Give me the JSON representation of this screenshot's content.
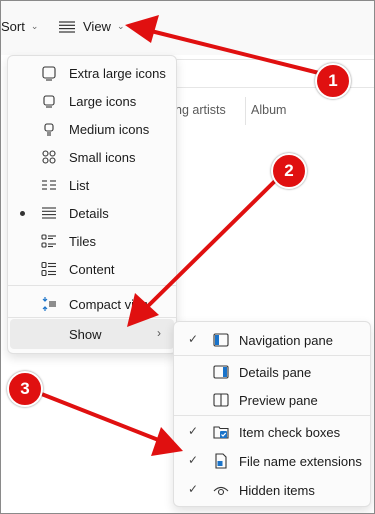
{
  "toolbar": {
    "sort_label": "Sort",
    "view_label": "View"
  },
  "columns": {
    "contributing_artists": "ng artists",
    "album": "Album"
  },
  "view_menu": {
    "items": [
      {
        "label": "Extra large icons",
        "icon": "extra-large-icons-icon"
      },
      {
        "label": "Large icons",
        "icon": "large-icons-icon"
      },
      {
        "label": "Medium icons",
        "icon": "medium-icons-icon"
      },
      {
        "label": "Small icons",
        "icon": "small-icons-icon"
      },
      {
        "label": "List",
        "icon": "list-icon"
      },
      {
        "label": "Details",
        "icon": "details-icon",
        "selected": true
      },
      {
        "label": "Tiles",
        "icon": "tiles-icon"
      },
      {
        "label": "Content",
        "icon": "content-icon"
      },
      {
        "label": "Compact view",
        "icon": "compact-view-icon"
      }
    ],
    "show_label": "Show"
  },
  "show_submenu": {
    "items": [
      {
        "label": "Navigation pane",
        "checked": true,
        "icon": "navigation-pane-icon"
      },
      {
        "label": "Details pane",
        "checked": false,
        "icon": "details-pane-icon"
      },
      {
        "label": "Preview pane",
        "checked": false,
        "icon": "preview-pane-icon"
      },
      {
        "label": "Item check boxes",
        "checked": true,
        "icon": "item-check-boxes-icon"
      },
      {
        "label": "File name extensions",
        "checked": true,
        "icon": "file-name-extensions-icon"
      },
      {
        "label": "Hidden items",
        "checked": true,
        "icon": "hidden-items-icon"
      }
    ]
  },
  "annotations": {
    "badge_1": "1",
    "badge_2": "2",
    "badge_3": "3",
    "color": "#e01010"
  },
  "checkmark": "✓",
  "submenu_arrow": "›",
  "chevron": "⌄"
}
